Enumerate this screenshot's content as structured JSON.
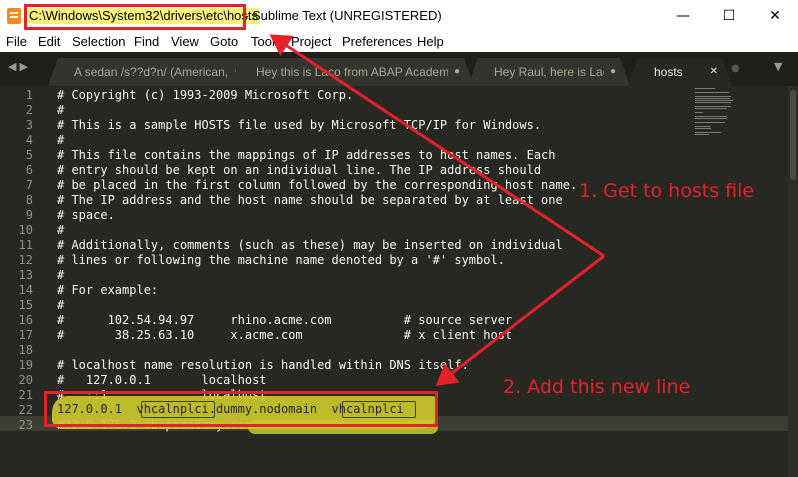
{
  "window": {
    "title_path": "C:\\Windows\\System32\\drivers\\etc\\hosts",
    "title_rest": "- Sublime Text (UNREGISTERED)",
    "minimize_glyph": "—",
    "maximize_glyph": "☐",
    "close_glyph": "✕"
  },
  "menu": [
    "File",
    "Edit",
    "Selection",
    "Find",
    "View",
    "Goto",
    "Tools",
    "Project",
    "Preferences",
    "Help"
  ],
  "tabbar": {
    "nav_glyph": "◀▶",
    "tabs": [
      {
        "label": "A sedan /s??d?n/ (American, Ca",
        "close": "●",
        "active": false
      },
      {
        "label": "Hey this is Laco from ABAP Academy.",
        "close": "●",
        "active": false
      },
      {
        "label": "Hey Raul, here is Laco.",
        "close": "●",
        "active": false
      },
      {
        "label": "hosts",
        "close": "✕",
        "active": true
      }
    ],
    "new_tab_glyph": "●",
    "dropdown_glyph": "▼"
  },
  "editor": {
    "lines": [
      {
        "n": "1",
        "text": "# Copyright (c) 1993-2009 Microsoft Corp."
      },
      {
        "n": "2",
        "text": "#"
      },
      {
        "n": "3",
        "text": "# This is a sample HOSTS file used by Microsoft TCP/IP for Windows."
      },
      {
        "n": "4",
        "text": "#"
      },
      {
        "n": "5",
        "text": "# This file contains the mappings of IP addresses to host names. Each"
      },
      {
        "n": "6",
        "text": "# entry should be kept on an individual line. The IP address should"
      },
      {
        "n": "7",
        "text": "# be placed in the first column followed by the corresponding host name."
      },
      {
        "n": "8",
        "text": "# The IP address and the host name should be separated by at least one"
      },
      {
        "n": "9",
        "text": "# space."
      },
      {
        "n": "10",
        "text": "#"
      },
      {
        "n": "11",
        "text": "# Additionally, comments (such as these) may be inserted on individual"
      },
      {
        "n": "12",
        "text": "# lines or following the machine name denoted by a '#' symbol."
      },
      {
        "n": "13",
        "text": "#"
      },
      {
        "n": "14",
        "text": "# For example:"
      },
      {
        "n": "15",
        "text": "#"
      },
      {
        "n": "16",
        "text": "#      102.54.94.97     rhino.acme.com          # source server"
      },
      {
        "n": "17",
        "text": "#       38.25.63.10     x.acme.com              # x client host"
      },
      {
        "n": "18",
        "text": ""
      },
      {
        "n": "19",
        "text": "# localhost name resolution is handled within DNS itself."
      },
      {
        "n": "20",
        "text": "#   127.0.0.1       localhost"
      },
      {
        "n": "21",
        "text": "#   ::1             localhost"
      },
      {
        "n": "22",
        "text": "127.0.0.1  vhcalnplci.dummy.nodomain  vhcalnplci"
      },
      {
        "n": "23",
        "text": "#37.9.175.3 abapacademy.com"
      }
    ]
  },
  "annotations": {
    "step1": "1. Get to hosts file",
    "step2": "2. Add this new line"
  },
  "colors": {
    "annotation_red": "#e5212b",
    "highlighter_yellow": "#c9c72b",
    "editor_bg": "#272822"
  }
}
